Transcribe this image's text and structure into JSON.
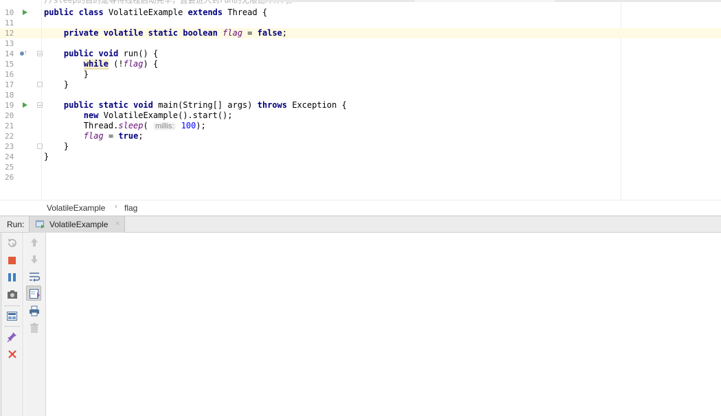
{
  "editor": {
    "truncated_top_comment": "//sleep的目的是等待线程启动完毕，且会进入到run的无限循环体内。",
    "lines": [
      {
        "num": "10",
        "gutter": "run"
      },
      {
        "num": "11"
      },
      {
        "num": "12",
        "current": true
      },
      {
        "num": "13"
      },
      {
        "num": "14",
        "gutter": "override"
      },
      {
        "num": "15"
      },
      {
        "num": "16"
      },
      {
        "num": "17"
      },
      {
        "num": "18"
      },
      {
        "num": "19",
        "gutter": "run"
      },
      {
        "num": "20"
      },
      {
        "num": "21"
      },
      {
        "num": "22"
      },
      {
        "num": "23"
      },
      {
        "num": "24"
      },
      {
        "num": "25"
      },
      {
        "num": "26"
      }
    ],
    "tokens": {
      "public": "public",
      "class": "class",
      "class_name": "VolatileExample",
      "extends": "extends",
      "thread": "Thread",
      "open_brace": "{",
      "close_brace": "}",
      "private": "private",
      "volatile": "volatile",
      "static": "static",
      "boolean": "boolean",
      "flag": "flag",
      "assign": "=",
      "false_kw": "false",
      "true_kw": "true",
      "semicolon": ";",
      "void": "void",
      "run_sig": "run() {",
      "while": "while",
      "not_open": "(!",
      "paren_close_brace": ") {",
      "main_sig": "main(String[] args)",
      "throws": "throws",
      "exception": "Exception {",
      "new": "new",
      "ctor_call": "VolatileExample().start();",
      "thread_dot": "Thread.",
      "sleep": "sleep",
      "paren_open": "(",
      "hint_label": "millis:",
      "sleep_value": "100",
      "close_call": ");"
    }
  },
  "breadcrumb": {
    "items": [
      "VolatileExample",
      "flag"
    ],
    "separator": "›"
  },
  "run_panel": {
    "label": "Run:",
    "tab": {
      "label": "VolatileExample",
      "close": "×"
    }
  },
  "toolbar_left": [
    "rerun-icon",
    "stop-icon",
    "pause-icon",
    "camera-icon",
    "layout-icon",
    "pin-icon",
    "close-icon"
  ],
  "toolbar_right": [
    "up-arrow-icon",
    "down-arrow-icon",
    "soft-wrap-icon",
    "scroll-to-end-icon",
    "print-icon",
    "trash-icon"
  ],
  "colors": {
    "keyword": "#000080",
    "field": "#660e7a",
    "number": "#0000ff",
    "current_line": "#fffae3",
    "run_arrow": "#4fa54f",
    "stop": "#e05a3b",
    "pause": "#3f7fbf"
  }
}
